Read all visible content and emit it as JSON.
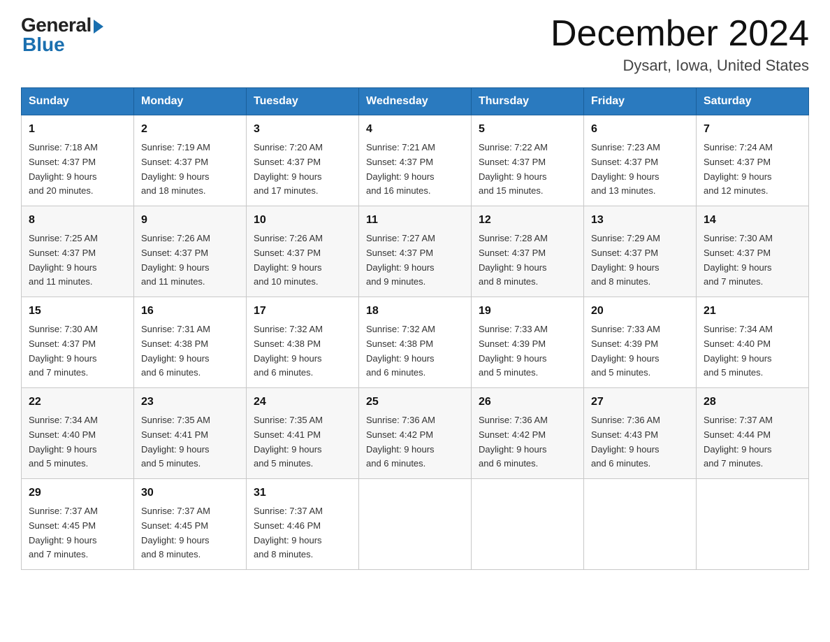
{
  "logo": {
    "general": "General",
    "blue": "Blue"
  },
  "title": {
    "month_year": "December 2024",
    "location": "Dysart, Iowa, United States"
  },
  "days_of_week": [
    "Sunday",
    "Monday",
    "Tuesday",
    "Wednesday",
    "Thursday",
    "Friday",
    "Saturday"
  ],
  "weeks": [
    [
      {
        "day": "1",
        "sunrise": "7:18 AM",
        "sunset": "4:37 PM",
        "daylight": "9 hours and 20 minutes."
      },
      {
        "day": "2",
        "sunrise": "7:19 AM",
        "sunset": "4:37 PM",
        "daylight": "9 hours and 18 minutes."
      },
      {
        "day": "3",
        "sunrise": "7:20 AM",
        "sunset": "4:37 PM",
        "daylight": "9 hours and 17 minutes."
      },
      {
        "day": "4",
        "sunrise": "7:21 AM",
        "sunset": "4:37 PM",
        "daylight": "9 hours and 16 minutes."
      },
      {
        "day": "5",
        "sunrise": "7:22 AM",
        "sunset": "4:37 PM",
        "daylight": "9 hours and 15 minutes."
      },
      {
        "day": "6",
        "sunrise": "7:23 AM",
        "sunset": "4:37 PM",
        "daylight": "9 hours and 13 minutes."
      },
      {
        "day": "7",
        "sunrise": "7:24 AM",
        "sunset": "4:37 PM",
        "daylight": "9 hours and 12 minutes."
      }
    ],
    [
      {
        "day": "8",
        "sunrise": "7:25 AM",
        "sunset": "4:37 PM",
        "daylight": "9 hours and 11 minutes."
      },
      {
        "day": "9",
        "sunrise": "7:26 AM",
        "sunset": "4:37 PM",
        "daylight": "9 hours and 11 minutes."
      },
      {
        "day": "10",
        "sunrise": "7:26 AM",
        "sunset": "4:37 PM",
        "daylight": "9 hours and 10 minutes."
      },
      {
        "day": "11",
        "sunrise": "7:27 AM",
        "sunset": "4:37 PM",
        "daylight": "9 hours and 9 minutes."
      },
      {
        "day": "12",
        "sunrise": "7:28 AM",
        "sunset": "4:37 PM",
        "daylight": "9 hours and 8 minutes."
      },
      {
        "day": "13",
        "sunrise": "7:29 AM",
        "sunset": "4:37 PM",
        "daylight": "9 hours and 8 minutes."
      },
      {
        "day": "14",
        "sunrise": "7:30 AM",
        "sunset": "4:37 PM",
        "daylight": "9 hours and 7 minutes."
      }
    ],
    [
      {
        "day": "15",
        "sunrise": "7:30 AM",
        "sunset": "4:37 PM",
        "daylight": "9 hours and 7 minutes."
      },
      {
        "day": "16",
        "sunrise": "7:31 AM",
        "sunset": "4:38 PM",
        "daylight": "9 hours and 6 minutes."
      },
      {
        "day": "17",
        "sunrise": "7:32 AM",
        "sunset": "4:38 PM",
        "daylight": "9 hours and 6 minutes."
      },
      {
        "day": "18",
        "sunrise": "7:32 AM",
        "sunset": "4:38 PM",
        "daylight": "9 hours and 6 minutes."
      },
      {
        "day": "19",
        "sunrise": "7:33 AM",
        "sunset": "4:39 PM",
        "daylight": "9 hours and 5 minutes."
      },
      {
        "day": "20",
        "sunrise": "7:33 AM",
        "sunset": "4:39 PM",
        "daylight": "9 hours and 5 minutes."
      },
      {
        "day": "21",
        "sunrise": "7:34 AM",
        "sunset": "4:40 PM",
        "daylight": "9 hours and 5 minutes."
      }
    ],
    [
      {
        "day": "22",
        "sunrise": "7:34 AM",
        "sunset": "4:40 PM",
        "daylight": "9 hours and 5 minutes."
      },
      {
        "day": "23",
        "sunrise": "7:35 AM",
        "sunset": "4:41 PM",
        "daylight": "9 hours and 5 minutes."
      },
      {
        "day": "24",
        "sunrise": "7:35 AM",
        "sunset": "4:41 PM",
        "daylight": "9 hours and 5 minutes."
      },
      {
        "day": "25",
        "sunrise": "7:36 AM",
        "sunset": "4:42 PM",
        "daylight": "9 hours and 6 minutes."
      },
      {
        "day": "26",
        "sunrise": "7:36 AM",
        "sunset": "4:42 PM",
        "daylight": "9 hours and 6 minutes."
      },
      {
        "day": "27",
        "sunrise": "7:36 AM",
        "sunset": "4:43 PM",
        "daylight": "9 hours and 6 minutes."
      },
      {
        "day": "28",
        "sunrise": "7:37 AM",
        "sunset": "4:44 PM",
        "daylight": "9 hours and 7 minutes."
      }
    ],
    [
      {
        "day": "29",
        "sunrise": "7:37 AM",
        "sunset": "4:45 PM",
        "daylight": "9 hours and 7 minutes."
      },
      {
        "day": "30",
        "sunrise": "7:37 AM",
        "sunset": "4:45 PM",
        "daylight": "9 hours and 8 minutes."
      },
      {
        "day": "31",
        "sunrise": "7:37 AM",
        "sunset": "4:46 PM",
        "daylight": "9 hours and 8 minutes."
      },
      null,
      null,
      null,
      null
    ]
  ],
  "labels": {
    "sunrise": "Sunrise:",
    "sunset": "Sunset:",
    "daylight": "Daylight:"
  }
}
